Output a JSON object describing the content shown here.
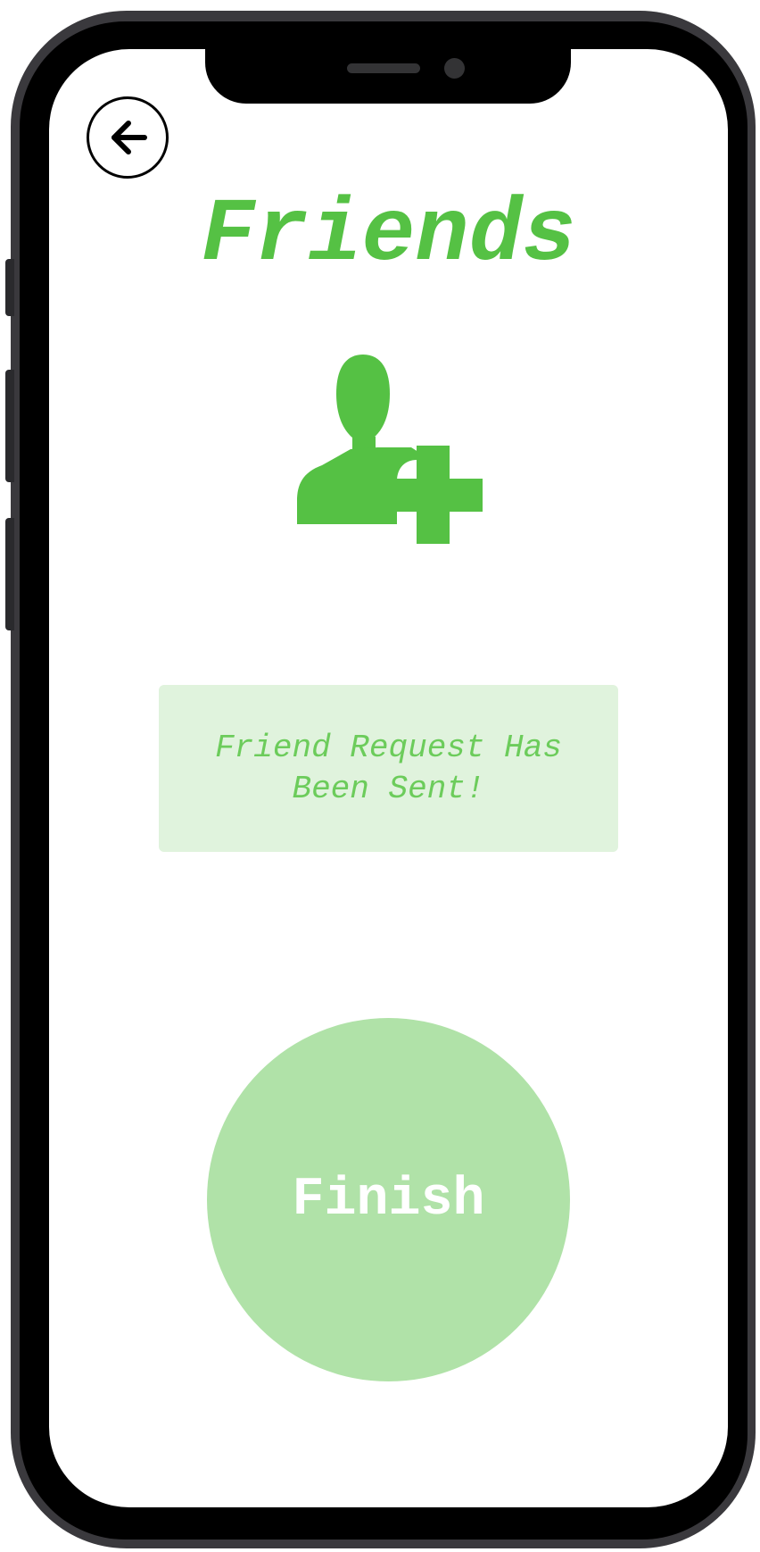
{
  "header": {
    "title": "Friends",
    "back_icon": "arrow-left-icon"
  },
  "hero": {
    "icon": "add-user-icon",
    "accent_color": "#55c144"
  },
  "status": {
    "message": "Friend Request Has Been Sent!",
    "background_color": "#e0f3dd",
    "text_color": "#6ccc5b"
  },
  "actions": {
    "finish_label": "Finish",
    "finish_color": "#b0e2a8"
  }
}
